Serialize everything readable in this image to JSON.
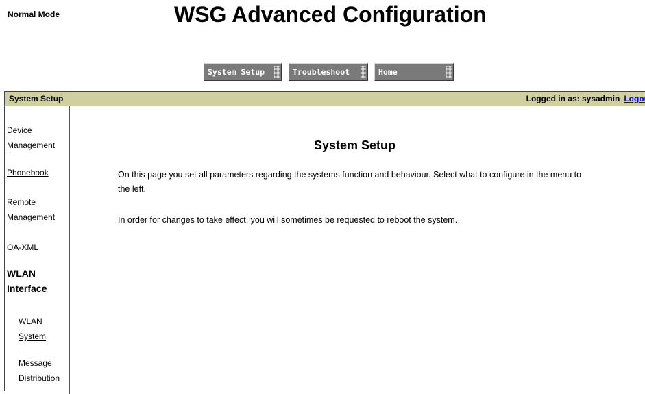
{
  "header": {
    "mode": "Normal Mode",
    "title": "WSG Advanced Configuration"
  },
  "nav": {
    "system_setup": "System Setup",
    "troubleshoot": "Troubleshoot",
    "home": "Home"
  },
  "bar": {
    "section": "System Setup",
    "logged_in": "Logged in as: sysadmin",
    "logout": "Logou"
  },
  "sidebar": {
    "device_management_1": "Device",
    "device_management_2": "Management",
    "phonebook": "Phonebook",
    "remote_management_1": "Remote",
    "remote_management_2": "Management",
    "oa_xml": "OA-XML",
    "wlan_interface_1": "WLAN",
    "wlan_interface_2": "Interface",
    "wlan_system_1": "WLAN",
    "wlan_system_2": "System",
    "message_distribution_1": "Message",
    "message_distribution_2": "Distribution"
  },
  "content": {
    "title": "System Setup",
    "paragraph1": "On this page you set all parameters regarding the systems function and behaviour. Select what to configure in the menu to the left.",
    "paragraph2": "In order for changes to take effect, you will sometimes be requested to reboot the system."
  },
  "colors": {
    "header_bar": "#cfcf9f",
    "nav_button": "#7a7a7a",
    "link": "#0000ee"
  }
}
